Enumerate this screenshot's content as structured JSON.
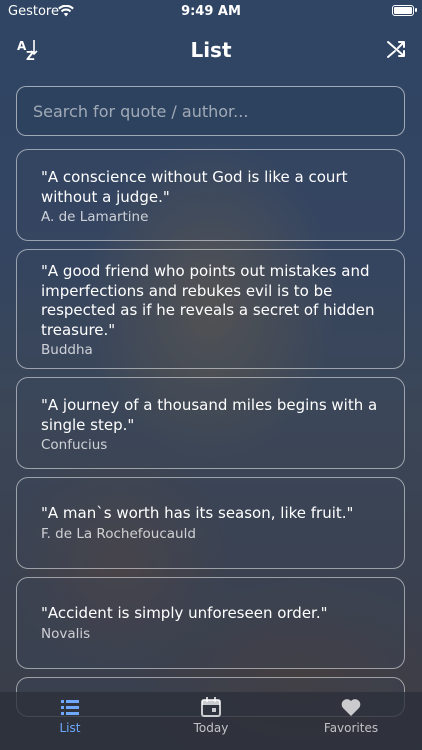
{
  "status_bar": {
    "carrier": "Gestore",
    "time": "9:49 AM"
  },
  "nav": {
    "title": "List",
    "sort_icon": "sort-az-icon",
    "shuffle_icon": "shuffle-icon"
  },
  "search": {
    "placeholder": "Search for quote / author..."
  },
  "quotes": [
    {
      "text": "\"A conscience without God is like a court without a judge.\"",
      "author": "A. de Lamartine"
    },
    {
      "text": "\"A good friend who points out mistakes and imperfections and rebukes evil is to be respected as if he reveals a secret of hidden treasure.\"",
      "author": "Buddha"
    },
    {
      "text": "\"A journey of a thousand miles begins with a single step.\"",
      "author": "Confucius"
    },
    {
      "text": "\"A man`s worth has its season, like fruit.\"",
      "author": "F. de La Rochefoucauld"
    },
    {
      "text": "\"Accident is simply unforeseen order.\"",
      "author": "Novalis"
    }
  ],
  "tabs": [
    {
      "label": "List",
      "icon": "list-icon",
      "active": true
    },
    {
      "label": "Today",
      "icon": "calendar-icon",
      "active": false
    },
    {
      "label": "Favorites",
      "icon": "heart-icon",
      "active": false
    }
  ],
  "colors": {
    "accent": "#6ea8ff",
    "background": "#334563"
  }
}
